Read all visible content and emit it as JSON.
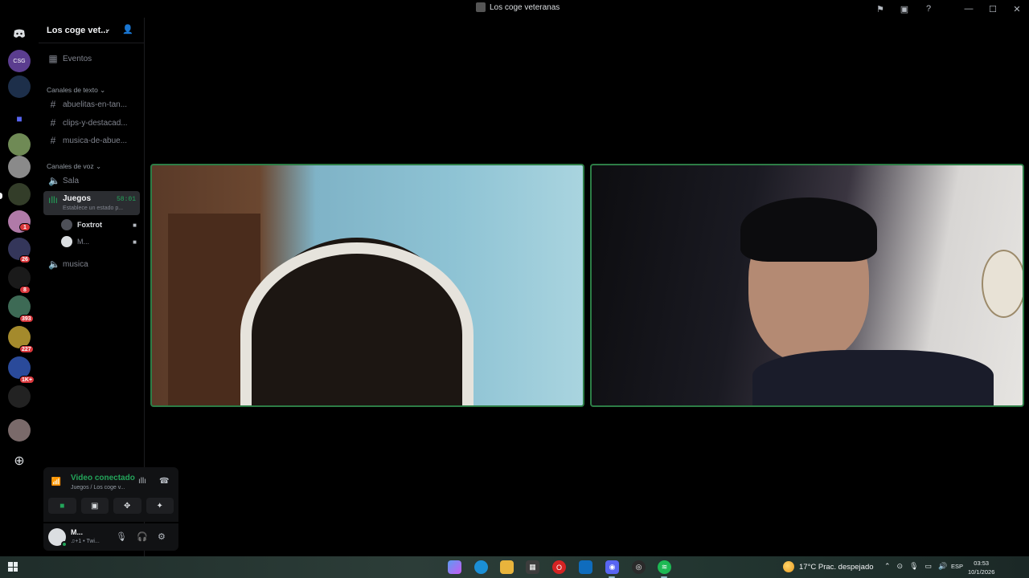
{
  "window": {
    "title": "Los coge veteranas"
  },
  "server": {
    "name": "Los coge vet...",
    "events_label": "Eventos"
  },
  "rail": {
    "badges": [
      "1",
      "26",
      "8",
      "393",
      "227",
      "1K+"
    ]
  },
  "categories": {
    "text": "Canales de texto",
    "voice": "Canales de voz"
  },
  "text_channels": [
    {
      "name": "abuelitas-en-tan..."
    },
    {
      "name": "clips-y-destacad..."
    },
    {
      "name": "musica-de-abue..."
    }
  ],
  "voice_channels": {
    "sala": "Sala",
    "juegos": {
      "name": "Juegos",
      "timer": "58:01",
      "status": "Establece un estado p..."
    },
    "members": [
      {
        "name": "Foxtrot"
      },
      {
        "name": "M..."
      }
    ],
    "musica": "musica"
  },
  "voice_panel": {
    "status": "Video conectado",
    "location": "Juegos / Los coge v..."
  },
  "user_panel": {
    "name": "M...",
    "activity": "♫+1 • Twi..."
  },
  "taskbar": {
    "weather": "17°C  Prac. despejado",
    "lang": "ESP",
    "time": "03:53",
    "date": "10/1/2026"
  },
  "colors": {
    "accent_green": "#23a55a",
    "tile_border": "#2d7d46",
    "badge_red": "#da373c"
  }
}
